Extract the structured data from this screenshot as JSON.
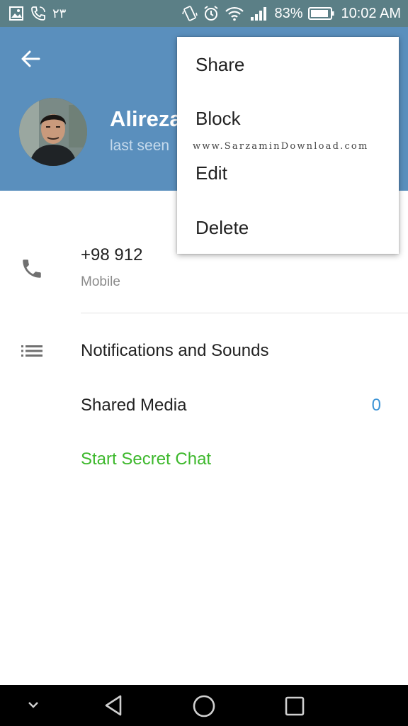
{
  "status_bar": {
    "left_text": "۲۳",
    "battery_percent": "83%",
    "time": "10:02 AM",
    "icons": [
      "gallery-icon",
      "phone-call-icon",
      "vibrate-icon",
      "alarm-icon",
      "wifi-icon",
      "signal-icon",
      "battery-icon"
    ]
  },
  "header": {
    "name": "Alireza",
    "last_seen": "last seen",
    "background": "#5a8fbd"
  },
  "menu": {
    "items": [
      "Share",
      "Block",
      "Edit",
      "Delete"
    ],
    "watermark": "www.SarzaminDownload.com"
  },
  "contact": {
    "phone": "+98 912",
    "phone_type": "Mobile"
  },
  "rows": {
    "notifications": "Notifications and Sounds",
    "shared_media": "Shared Media",
    "shared_media_count": "0",
    "secret_chat": "Start Secret Chat"
  },
  "colors": {
    "accent_blue": "#3d94d6",
    "secret_green": "#3db82c",
    "status_bar": "#5b7f86"
  }
}
